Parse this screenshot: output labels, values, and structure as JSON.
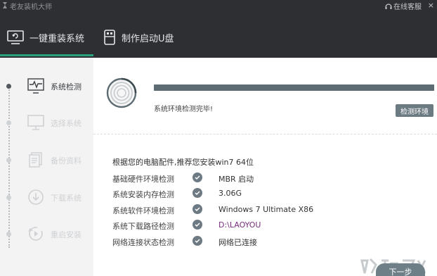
{
  "app": {
    "title": "老友装机大师",
    "online_service": "在线客服",
    "close_glyph": "×"
  },
  "tabs": [
    {
      "label": "一键重装系统",
      "icon": "monitor-refresh-icon",
      "active": true
    },
    {
      "label": "制作启动U盘",
      "icon": "usb-drive-icon",
      "active": false
    }
  ],
  "sidebar": {
    "steps": [
      {
        "label": "系统检测",
        "icon": "pulse-monitor-icon",
        "active": true
      },
      {
        "label": "选择系统",
        "icon": "desktop-icon",
        "active": false
      },
      {
        "label": "备份资料",
        "icon": "documents-icon",
        "active": false
      },
      {
        "label": "下载系统",
        "icon": "download-icon",
        "active": false
      },
      {
        "label": "重启安装",
        "icon": "restart-icon",
        "active": false
      }
    ]
  },
  "detection": {
    "progress": 1.0,
    "status": "系统环境检测完毕!",
    "check_button": "检测环境"
  },
  "recommendation": "根据您的电脑配件,推荐您安装win7 64位",
  "checks": [
    {
      "label": "基础硬件环境检测",
      "value": "MBR 启动"
    },
    {
      "label": "系统安装内存检测",
      "value": "3.06G"
    },
    {
      "label": "系统软件环境检测",
      "value": "Windows 7 Ultimate X86"
    },
    {
      "label": "系统下载路径检测",
      "value": "D:\\LAOYOU"
    },
    {
      "label": "网络连接状态检测",
      "value": "网络已连接"
    }
  ],
  "next_button": "下一步",
  "colors": {
    "header_bg": "#2d2f33",
    "accent_green": "#29a17a",
    "button_gray": "#6c7a82",
    "path_purple": "#7a2c7f"
  }
}
